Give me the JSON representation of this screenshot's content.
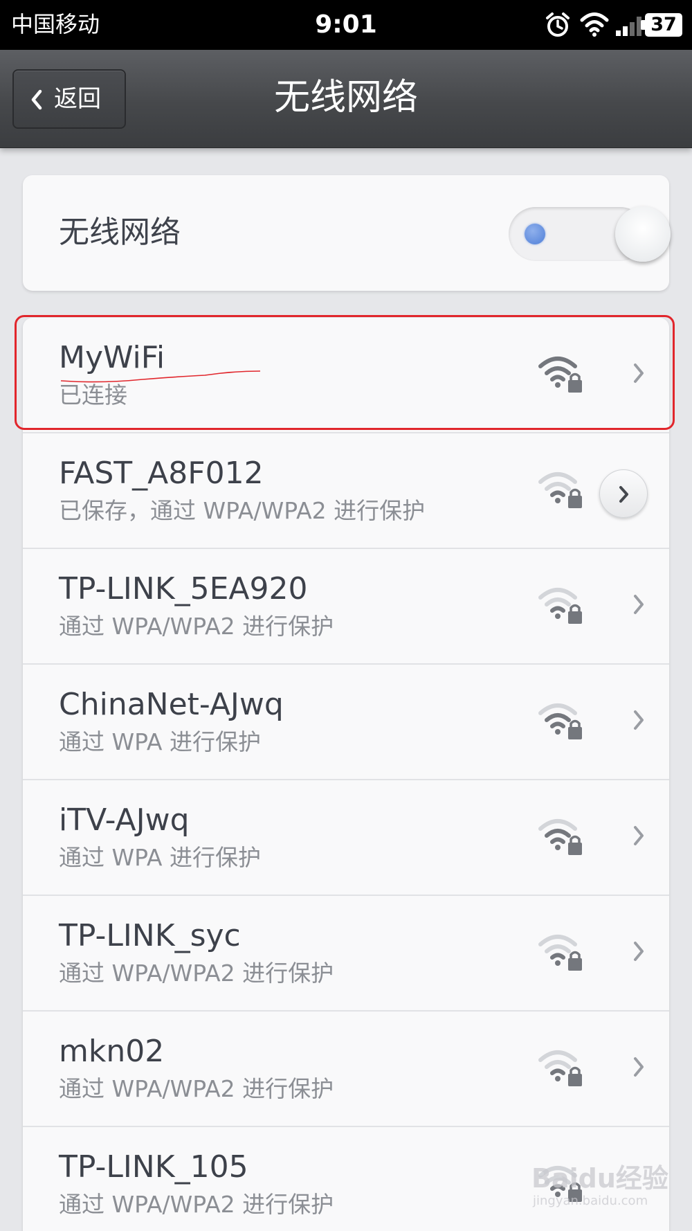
{
  "status_bar": {
    "carrier": "中国移动",
    "time": "9:01",
    "battery": "37",
    "icons": [
      "alarm-icon",
      "wifi-signal-icon",
      "cellular-signal-icon",
      "battery-icon"
    ]
  },
  "title_bar": {
    "back_label": "返回",
    "title": "无线网络"
  },
  "wifi_toggle": {
    "label": "无线网络",
    "state": "on"
  },
  "networks": [
    {
      "ssid": "MyWiFi",
      "status": "已连接",
      "signal": "strong",
      "secured": true,
      "connected": true
    },
    {
      "ssid": "FAST_A8F012",
      "status": "已保存，通过 WPA/WPA2 进行保护",
      "signal": "weak",
      "secured": true,
      "connected": false
    },
    {
      "ssid": "TP-LINK_5EA920",
      "status": "通过 WPA/WPA2 进行保护",
      "signal": "weak",
      "secured": true,
      "connected": false
    },
    {
      "ssid": "ChinaNet-AJwq",
      "status": "通过 WPA 进行保护",
      "signal": "medium",
      "secured": true,
      "connected": false
    },
    {
      "ssid": "iTV-AJwq",
      "status": "通过 WPA 进行保护",
      "signal": "medium",
      "secured": true,
      "connected": false
    },
    {
      "ssid": "TP-LINK_syc",
      "status": "通过 WPA/WPA2 进行保护",
      "signal": "weak",
      "secured": true,
      "connected": false
    },
    {
      "ssid": "mkn02",
      "status": "通过 WPA/WPA2 进行保护",
      "signal": "weak",
      "secured": true,
      "connected": false
    },
    {
      "ssid": "TP-LINK_105",
      "status": "通过 WPA/WPA2 进行保护",
      "signal": "weak",
      "secured": true,
      "connected": false
    }
  ],
  "watermark": {
    "logo": "Baidu经验",
    "url": "jingyan.baidu.com"
  },
  "colors": {
    "highlight": "#e1262c",
    "toggle_on": "#4f7fd8",
    "title_bar": "#46484b"
  }
}
